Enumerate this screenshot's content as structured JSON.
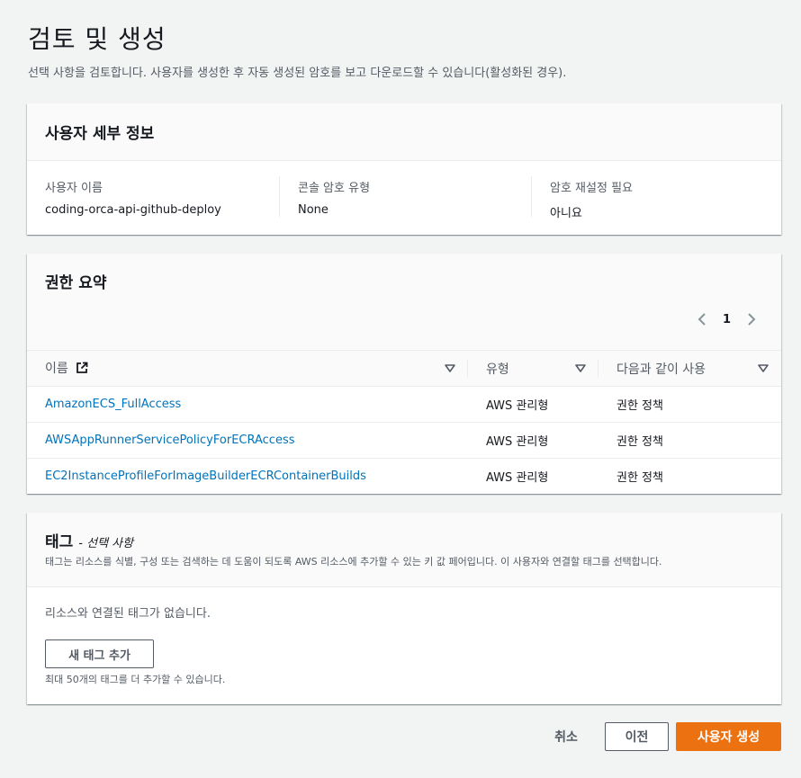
{
  "page": {
    "title": "검토 및 생성",
    "description": "선택 사항을 검토합니다. 사용자를 생성한 후 자동 생성된 암호를 보고 다운로드할 수 있습니다(활성화된 경우)."
  },
  "user_details": {
    "title": "사용자 세부 정보",
    "fields": [
      {
        "label": "사용자 이름",
        "value": "coding-orca-api-github-deploy"
      },
      {
        "label": "콘솔 암호 유형",
        "value": "None"
      },
      {
        "label": "암호 재설정 필요",
        "value": "아니요"
      }
    ]
  },
  "permissions": {
    "title": "권한 요약",
    "pagination": {
      "current_page": "1"
    },
    "columns": [
      "이름",
      "유형",
      "다음과 같이 사용"
    ],
    "rows": [
      {
        "name": "AmazonECS_FullAccess",
        "type": "AWS 관리형",
        "used_as": "권한 정책"
      },
      {
        "name": "AWSAppRunnerServicePolicyForECRAccess",
        "type": "AWS 관리형",
        "used_as": "권한 정책"
      },
      {
        "name": "EC2InstanceProfileForImageBuilderECRContainerBuilds",
        "type": "AWS 관리형",
        "used_as": "권한 정책"
      }
    ]
  },
  "tags": {
    "title": "태그",
    "optional": "- 선택 사항",
    "description": "태그는 리소스를 식별, 구성 또는 검색하는 데 도움이 되도록 AWS 리소스에 추가할 수 있는 키 값 페어입니다. 이 사용자와 연결할 태그를 선택합니다.",
    "empty_message": "리소스와 연결된 태그가 없습니다.",
    "add_button": "새 태그 추가",
    "limit_note": "최대 50개의 태그를 더 추가할 수 있습니다."
  },
  "footer": {
    "cancel": "취소",
    "previous": "이전",
    "create": "사용자 생성"
  },
  "colors": {
    "accent": "#ec7211",
    "link": "#0073bb"
  }
}
